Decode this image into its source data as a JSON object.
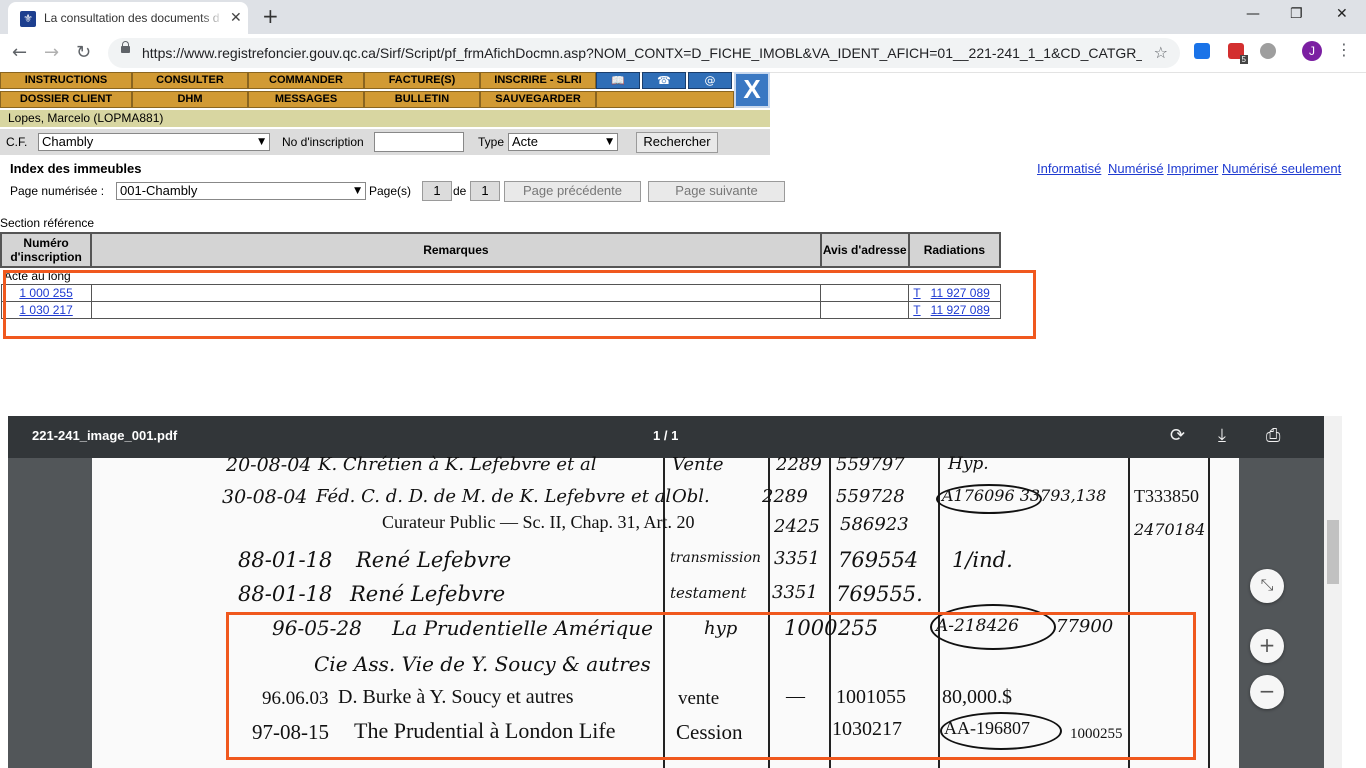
{
  "browser": {
    "tab_title": "La consultation des documents d",
    "tab_close": "✕",
    "new_tab": "+",
    "url": "https://www.registrefoncier.gouv.qc.ca/Sirf/Script/pf_frmAfichDocmn.asp?NOM_CONTX=D_FICHE_IMOBL&VA_IDENT_AFICH=01__221-241_1_1&CD_CATGR_PRO...",
    "avatar_letter": "J",
    "ext_badge": "5",
    "back": "←",
    "forward": "→",
    "reload": "↻",
    "star": "☆",
    "menu": "⋮",
    "minimize": "—",
    "maximize": "❐",
    "close": "✕"
  },
  "nav": {
    "row1": [
      "INSTRUCTIONS",
      "CONSULTER",
      "COMMANDER",
      "FACTURE(S)",
      "INSCRIRE - SLRI"
    ],
    "row2": [
      "DOSSIER CLIENT",
      "DHM",
      "MESSAGES",
      "BULLETIN",
      "SAUVEGARDER"
    ],
    "icons": [
      "📖",
      "☎",
      "@"
    ],
    "close": "X"
  },
  "user": "Lopes, Marcelo (LOPMA881)",
  "search": {
    "cf_label": "C.F.",
    "cf_value": "Chambly",
    "no_label": "No d'inscription",
    "no_value": "",
    "type_label": "Type",
    "type_value": "Acte",
    "button": "Rechercher",
    "arrow": "▼"
  },
  "index": {
    "title": "Index des immeubles",
    "links": [
      "Informatisé",
      "Numérisé",
      "Imprimer",
      "Numérisé seulement"
    ],
    "page_label": "Page numérisée :",
    "page_value": "001-Chambly",
    "pages_label": "Page(s)",
    "page_current": "1",
    "de": "de",
    "page_total": "1",
    "prev": "Page précédente",
    "next": "Page suivante"
  },
  "section": "Section référence",
  "table": {
    "headers": [
      "Numéro d'inscription",
      "Remarques",
      "Avis d'adresse",
      "Radiations"
    ],
    "group": "Acte au long",
    "rows": [
      {
        "number": "1 000 255",
        "remarks": "",
        "avis": "",
        "rad_type": "T",
        "rad_number": "11 927 089"
      },
      {
        "number": "1 030 217",
        "remarks": "",
        "avis": "",
        "rad_type": "T",
        "rad_number": "11 927 089"
      }
    ]
  },
  "pdf": {
    "filename": "221-241_image_001.pdf",
    "page": "1 / 1",
    "rotate": "⟳",
    "download": "⤓",
    "print": "⎙",
    "zoom_fit": "⤡",
    "zoom_in": "+",
    "zoom_out": "−",
    "lines": [
      {
        "date": "20-08-04",
        "text": "K. Chrétien à K. Lefebvre et al",
        "nature": "Vente",
        "vol": "2289",
        "num": "559797",
        "extra": "Hyp."
      },
      {
        "date": "30-08-04",
        "text": "Féd. C. d. D. de M. de K. Lefebvre et al",
        "nature": "Obl.",
        "vol": "2289",
        "num": "559728",
        "extra": "A176096 33793,138",
        "side": "T333850"
      },
      {
        "date": "",
        "text": "Curateur Public — Sc. II, Chap. 31, Art. 20",
        "nature": "",
        "vol": "2425",
        "num": "586923",
        "side": "2470184"
      },
      {
        "date": "88-01-18",
        "text": "René Lefebvre",
        "nature": "transmission",
        "vol": "3351",
        "num": "769554",
        "extra": "1/ind."
      },
      {
        "date": "88-01-18",
        "text": "René Lefebvre",
        "nature": "testament",
        "vol": "3351",
        "num": "769555."
      },
      {
        "date": "96-05-28",
        "text": "La Prudentielle Amérique",
        "nature": "hyp",
        "vol": "1000",
        "num": "255",
        "extra": "A-218426",
        "amount": "77900"
      },
      {
        "date": "",
        "text": "Cie Ass. Vie de Y. Soucy & autres"
      },
      {
        "date": "96.06.03",
        "text": "D. Burke à Y. Soucy et autres",
        "nature": "vente",
        "vol": "—",
        "num": "1001055",
        "extra": "80,000.$"
      },
      {
        "date": "97-08-15",
        "text": "The Prudential à London Life",
        "nature": "Cession",
        "num": "1030217",
        "extra": "AA-196807",
        "side": "1000255"
      }
    ]
  }
}
